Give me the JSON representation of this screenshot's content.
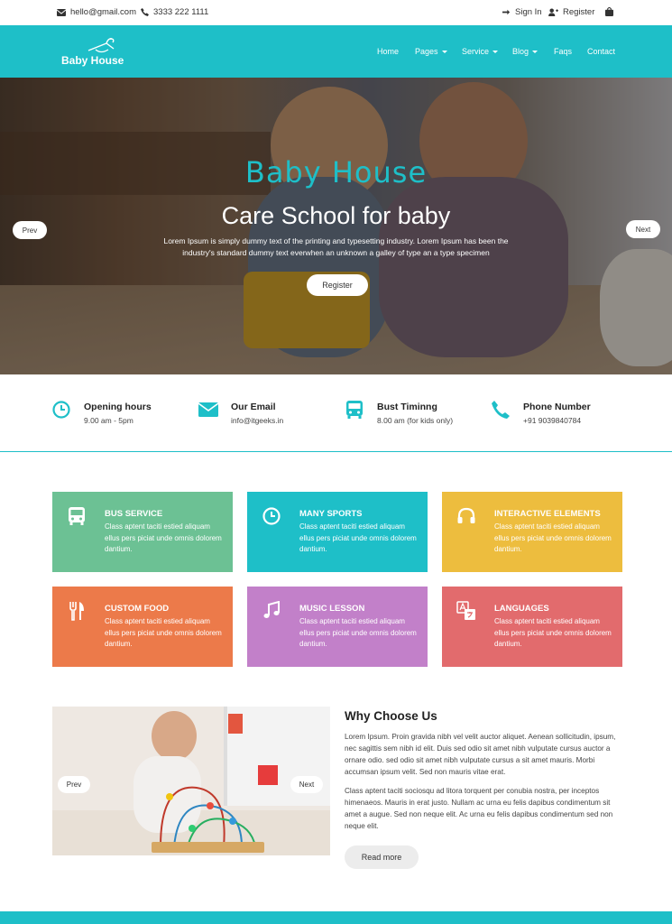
{
  "topbar": {
    "email": "hello@gmail.com",
    "phone": "3333 222 1111",
    "signin": "Sign In",
    "register": "Register"
  },
  "nav": {
    "logo_text": "Baby House",
    "items": [
      {
        "label": "Home",
        "dropdown": false
      },
      {
        "label": "Pages",
        "dropdown": true
      },
      {
        "label": "Service",
        "dropdown": true
      },
      {
        "label": "Blog",
        "dropdown": true
      },
      {
        "label": "Faqs",
        "dropdown": false
      },
      {
        "label": "Contact",
        "dropdown": false
      }
    ]
  },
  "hero": {
    "script_title": "Baby House",
    "title": "Care School for baby",
    "description": "Lorem Ipsum is simply dummy text of the printing and typesetting industry. Lorem Ipsum has been the industry's standard dummy text everwhen an unknown a galley of type an a type specimen",
    "button": "Register",
    "prev": "Prev",
    "next": "Next"
  },
  "info": [
    {
      "title": "Opening hours",
      "sub": "9.00 am - 5pm",
      "icon": "clock-icon"
    },
    {
      "title": "Our Email",
      "sub": "info@itgeeks.in",
      "icon": "envelope-icon"
    },
    {
      "title": "Bust Timinng",
      "sub": "8.00 am (for kids only)",
      "icon": "bus-icon"
    },
    {
      "title": "Phone Number",
      "sub": "+91 9039840784",
      "icon": "phone-icon"
    }
  ],
  "features": [
    {
      "title": "BUS SERVICE",
      "desc": "Class aptent taciti estied aliquam ellus pers piciat unde omnis dolorem dantium.",
      "color": "#6cc194",
      "icon": "bus-icon"
    },
    {
      "title": "MANY SPORTS",
      "desc": "Class aptent taciti estied aliquam ellus pers piciat unde omnis dolorem dantium.",
      "color": "#1ebfc8",
      "icon": "clock-icon"
    },
    {
      "title": "INTERACTIVE ELEMENTS",
      "desc": "Class aptent taciti estied aliquam ellus pers piciat unde omnis dolorem dantium.",
      "color": "#edbd3e",
      "icon": "headphones-icon"
    },
    {
      "title": "CUSTOM FOOD",
      "desc": "Class aptent taciti estied aliquam ellus pers piciat unde omnis dolorem dantium.",
      "color": "#ec7a4a",
      "icon": "cutlery-icon"
    },
    {
      "title": "MUSIC LESSON",
      "desc": "Class aptent taciti estied aliquam ellus pers piciat unde omnis dolorem dantium.",
      "color": "#c280c9",
      "icon": "music-icon"
    },
    {
      "title": "LANGUAGES",
      "desc": "Class aptent taciti estied aliquam ellus pers piciat unde omnis dolorem dantium.",
      "color": "#e26b6d",
      "icon": "language-icon"
    }
  ],
  "why": {
    "title": "Why Choose Us",
    "p1": "Lorem Ipsum. Proin gravida nibh vel velit auctor aliquet. Aenean sollicitudin, ipsum, nec sagittis sem nibh id elit. Duis sed odio sit amet nibh vulputate cursus auctor a ornare odio. sed odio sit amet nibh vulputate cursus a sit amet mauris. Morbi accumsan ipsum velit. Sed non mauris vitae erat.",
    "p2": "Class aptent taciti sociosqu ad litora torquent per conubia nostra, per inceptos himenaeos. Mauris in erat justo. Nullam ac urna eu felis dapibus condimentum sit amet a augue. Sed non neque elit. Ac urna eu felis dapibus condimentum sed non neque elit.",
    "button": "Read more",
    "prev": "Prev",
    "next": "Next"
  },
  "colors": {
    "accent": "#1ebfc8"
  }
}
